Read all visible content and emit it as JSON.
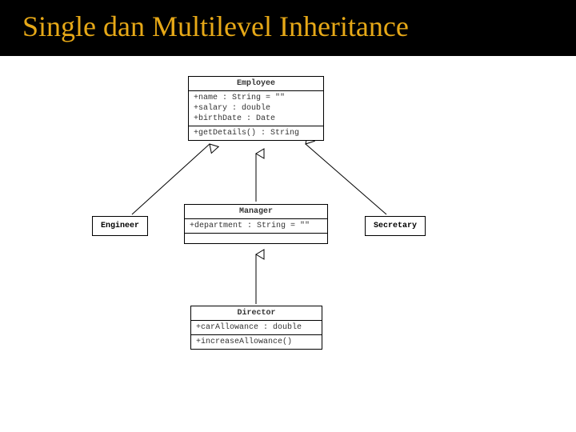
{
  "title": "Single dan Multilevel Inheritance",
  "classes": {
    "employee": {
      "name": "Employee",
      "attrs": [
        "+name : String = \"\"",
        "+salary : double",
        "+birthDate : Date"
      ],
      "ops": [
        "+getDetails() : String"
      ]
    },
    "engineer": {
      "name": "Engineer"
    },
    "manager": {
      "name": "Manager",
      "attrs": [
        "+department : String = \"\""
      ],
      "ops": []
    },
    "secretary": {
      "name": "Secretary"
    },
    "director": {
      "name": "Director",
      "attrs": [
        "+carAllowance : double"
      ],
      "ops": [
        "+increaseAllowance()"
      ]
    }
  },
  "relationships": [
    {
      "child": "Engineer",
      "parent": "Employee",
      "type": "generalization"
    },
    {
      "child": "Manager",
      "parent": "Employee",
      "type": "generalization"
    },
    {
      "child": "Secretary",
      "parent": "Employee",
      "type": "generalization"
    },
    {
      "child": "Director",
      "parent": "Manager",
      "type": "generalization"
    }
  ]
}
